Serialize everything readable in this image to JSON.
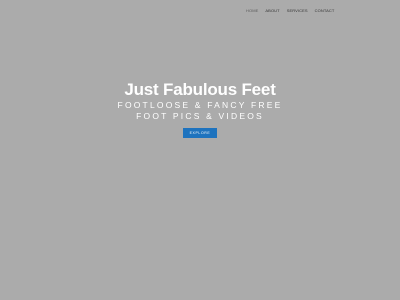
{
  "nav": {
    "items": [
      {
        "label": "HOME",
        "active": true
      },
      {
        "label": "ABOUT"
      },
      {
        "label": "SERVICES"
      },
      {
        "label": "CONTACT"
      }
    ]
  },
  "hero": {
    "title": "Just Fabulous Feet",
    "subtitle_line1": "FOOTLOOSE & FANCY FREE",
    "subtitle_line2": "FOOT PICS & VIDEOS",
    "button_label": "EXPLORE"
  },
  "colors": {
    "background": "#ababab",
    "accent": "#1e73be",
    "text": "#ffffff"
  }
}
